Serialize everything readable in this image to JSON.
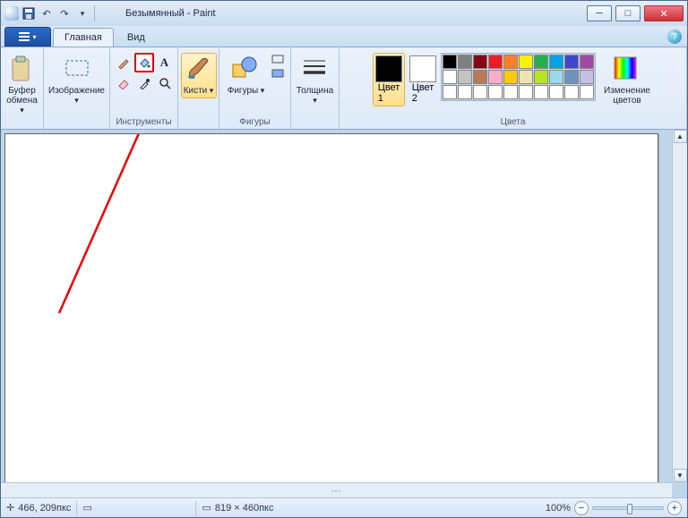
{
  "title": "Безымянный - Paint",
  "tabs": {
    "file": "",
    "home": "Главная",
    "view": "Вид"
  },
  "groups": {
    "clipboard": {
      "label": "",
      "button": "Буфер\nобмена"
    },
    "image": {
      "label": "",
      "button": "Изображение"
    },
    "tools": {
      "label": "Инструменты"
    },
    "brushes": {
      "label": "",
      "button": "Кисти"
    },
    "shapes": {
      "label": "Фигуры",
      "button": "Фигуры"
    },
    "size": {
      "label": "",
      "button": "Толщина"
    },
    "colors": {
      "label": "Цвета",
      "c1": "Цвет\n1",
      "c2": "Цвет\n2",
      "edit": "Изменение\nцветов"
    }
  },
  "palette_row1": [
    "#000000",
    "#7f7f7f",
    "#880015",
    "#ed1c24",
    "#ff7f27",
    "#fff200",
    "#22b14c",
    "#00a2e8",
    "#3f48cc",
    "#a349a4"
  ],
  "palette_row2": [
    "#ffffff",
    "#c3c3c3",
    "#b97a57",
    "#ffaec9",
    "#ffc90e",
    "#efe4b0",
    "#b5e61d",
    "#99d9ea",
    "#7092be",
    "#c8bfe7"
  ],
  "palette_row3": [
    "#ffffff",
    "#ffffff",
    "#ffffff",
    "#ffffff",
    "#ffffff",
    "#ffffff",
    "#ffffff",
    "#ffffff",
    "#ffffff",
    "#ffffff"
  ],
  "color1": "#000000",
  "color2": "#ffffff",
  "status": {
    "cursor_icon": "⊕",
    "pos": "466, 209пкс",
    "sel": "",
    "dim_icon": "▭",
    "dim": "819 × 460пкс",
    "zoom": "100%"
  }
}
